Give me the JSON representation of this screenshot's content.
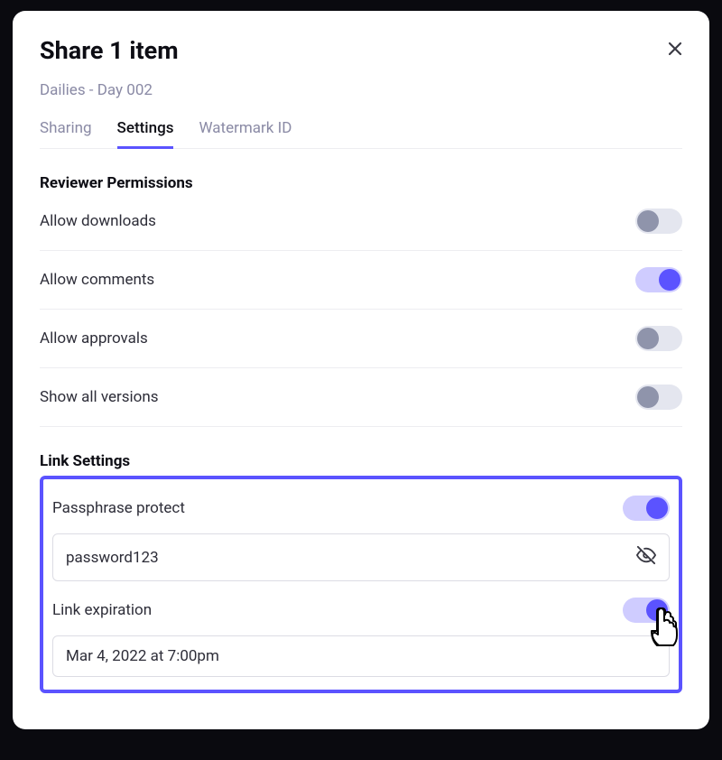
{
  "modal": {
    "title": "Share 1 item",
    "subtitle": "Dailies - Day 002"
  },
  "tabs": {
    "sharing": "Sharing",
    "settings": "Settings",
    "watermark": "Watermark ID"
  },
  "sections": {
    "reviewer_permissions": "Reviewer Permissions",
    "link_settings": "Link Settings"
  },
  "rows": {
    "allow_downloads": "Allow downloads",
    "allow_comments": "Allow comments",
    "allow_approvals": "Allow approvals",
    "show_all_versions": "Show all versions",
    "passphrase_protect": "Passphrase protect",
    "link_expiration": "Link expiration"
  },
  "values": {
    "passphrase": "password123",
    "expiration": "Mar 4, 2022 at 7:00pm"
  }
}
